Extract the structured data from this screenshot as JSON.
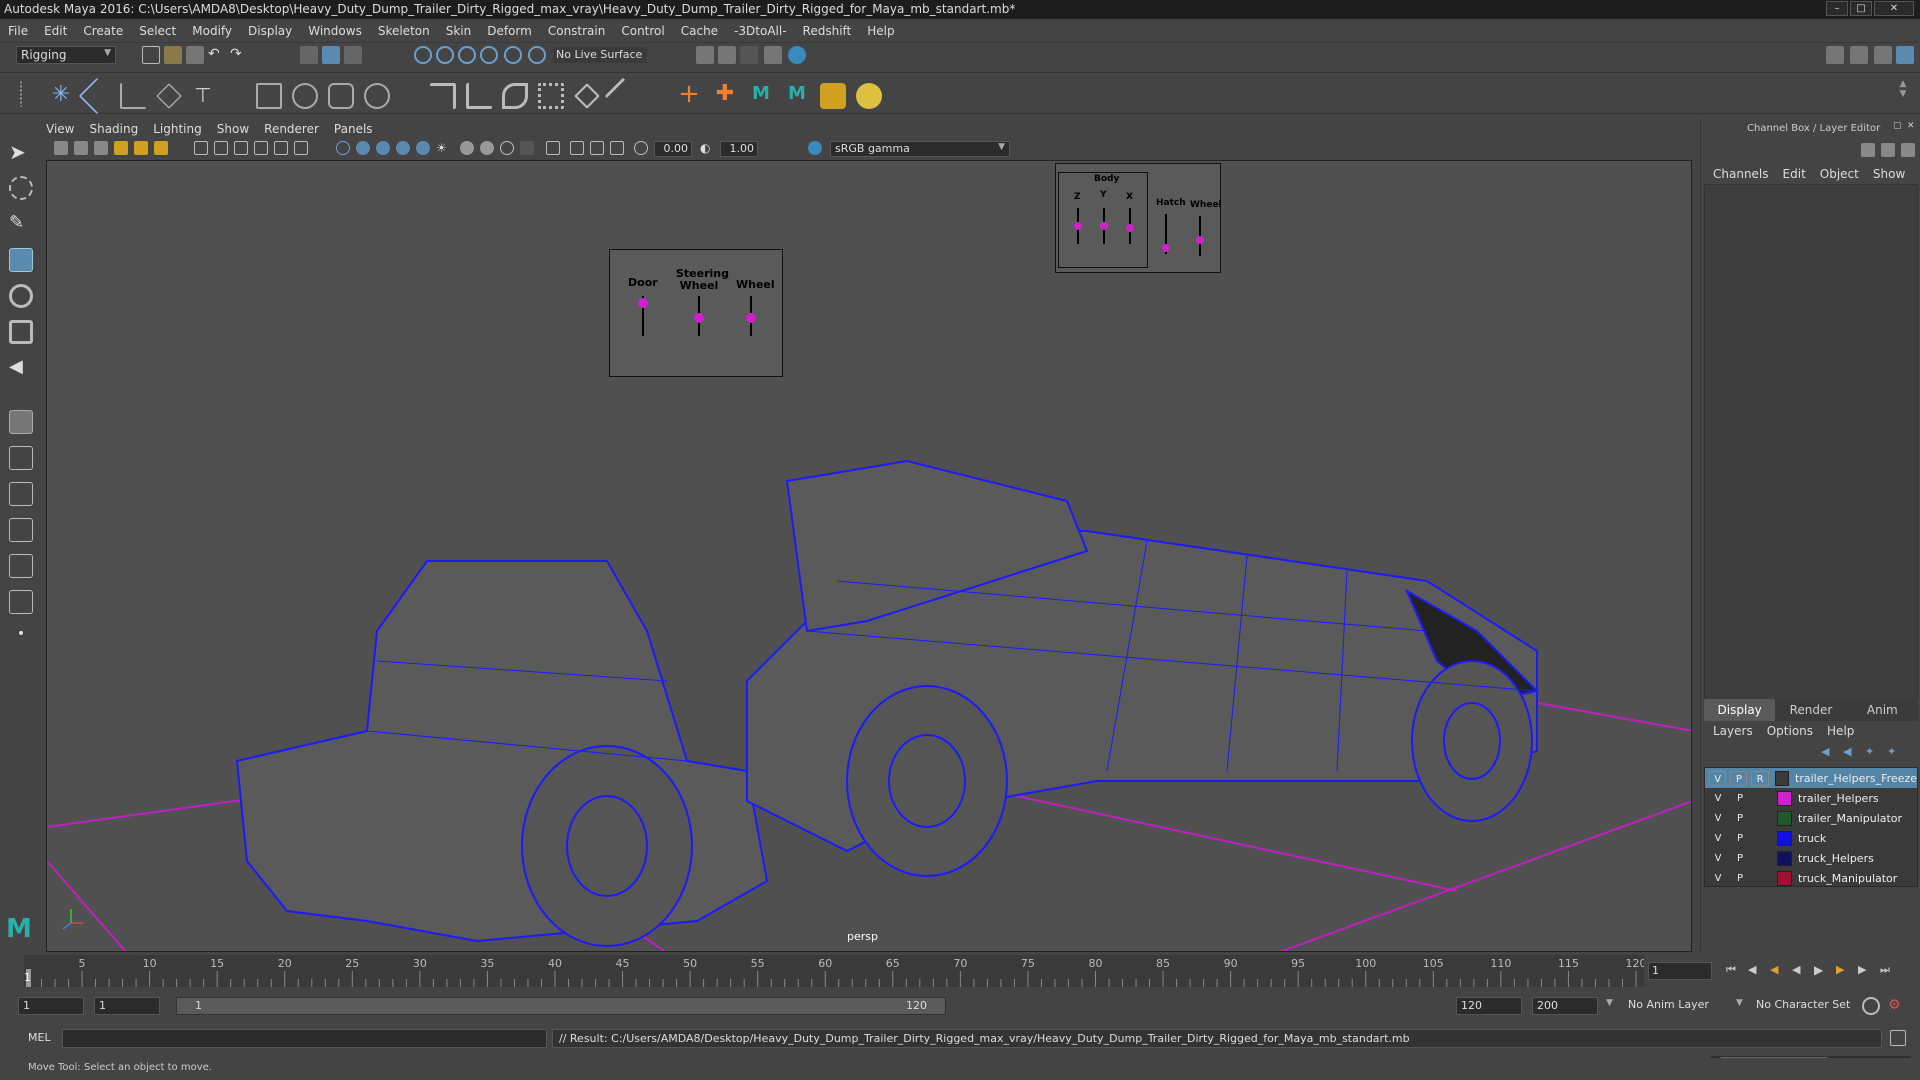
{
  "window": {
    "title": "Autodesk Maya 2016: C:\\Users\\AMDA8\\Desktop\\Heavy_Duty_Dump_Trailer_Dirty_Rigged_max_vray\\Heavy_Duty_Dump_Trailer_Dirty_Rigged_for_Maya_mb_standart.mb*",
    "minimize": "–",
    "maximize": "□",
    "close": "✕"
  },
  "menubar": [
    "File",
    "Edit",
    "Create",
    "Select",
    "Modify",
    "Display",
    "Windows",
    "Skeleton",
    "Skin",
    "Deform",
    "Constrain",
    "Control",
    "Cache",
    "-3DtoAll-",
    "Redshift",
    "Help"
  ],
  "statusline": {
    "mode": "Rigging",
    "live_surface": "No Live Surface"
  },
  "panel_menu": [
    "View",
    "Shading",
    "Lighting",
    "Show",
    "Renderer",
    "Panels"
  ],
  "panel_toolbar": {
    "exposure": "0.00",
    "gamma": "1.00",
    "color_space": "sRGB gamma"
  },
  "viewport": {
    "camera": "persp",
    "control_panel_1": {
      "labels": [
        "Door",
        "Steering Wheel",
        "Wheel"
      ]
    },
    "control_panel_2": {
      "group_label": "Body",
      "labels": [
        "Z",
        "Y",
        "X",
        "Hatch",
        "Wheel"
      ]
    }
  },
  "right_panel": {
    "title": "Channel Box / Layer Editor",
    "menu": [
      "Channels",
      "Edit",
      "Object",
      "Show"
    ],
    "tabs": [
      "Display",
      "Render",
      "Anim"
    ],
    "active_tab": "Display",
    "layer_menu": [
      "Layers",
      "Options",
      "Help"
    ],
    "layers": [
      {
        "v": "V",
        "p": "P",
        "r": "R",
        "name": "trailer_Helpers_Freeze",
        "color": "#3a3a3a",
        "selected": true
      },
      {
        "v": "V",
        "p": "P",
        "r": "",
        "name": "trailer_Helpers",
        "color": "#d020d0",
        "selected": false
      },
      {
        "v": "V",
        "p": "P",
        "r": "",
        "name": "trailer_Manipulator",
        "color": "#1f5a2a",
        "selected": false
      },
      {
        "v": "V",
        "p": "P",
        "r": "",
        "name": "truck",
        "color": "#1010e0",
        "selected": false
      },
      {
        "v": "V",
        "p": "P",
        "r": "",
        "name": "truck_Helpers",
        "color": "#101060",
        "selected": false
      },
      {
        "v": "V",
        "p": "P",
        "r": "",
        "name": "truck_Manipulator",
        "color": "#a01030",
        "selected": false
      }
    ]
  },
  "time_slider": {
    "ticks": [
      "5",
      "10",
      "15",
      "20",
      "25",
      "30",
      "35",
      "40",
      "45",
      "50",
      "55",
      "60",
      "65",
      "70",
      "75",
      "80",
      "85",
      "90",
      "95",
      "100",
      "105",
      "110",
      "115",
      "120"
    ],
    "frame_marker": "1",
    "current_frame": "1"
  },
  "range": {
    "start": "1",
    "playback_start": "1",
    "slider_start": "1",
    "slider_end": "120",
    "playback_end": "120",
    "end": "200",
    "anim_layer": "No Anim Layer",
    "character_set": "No Character Set"
  },
  "command": {
    "language": "MEL",
    "result": "// Result: C:/Users/AMDA8/Desktop/Heavy_Duty_Dump_Trailer_Dirty_Rigged_max_vray/Heavy_Duty_Dump_Trailer_Dirty_Rigged_for_Maya_mb_standart.mb"
  },
  "help_line": "Move Tool: Select an object to move.",
  "colors": {
    "wire": "#1a1aff",
    "grid": "#c020c0",
    "selection": "#5285a6"
  }
}
